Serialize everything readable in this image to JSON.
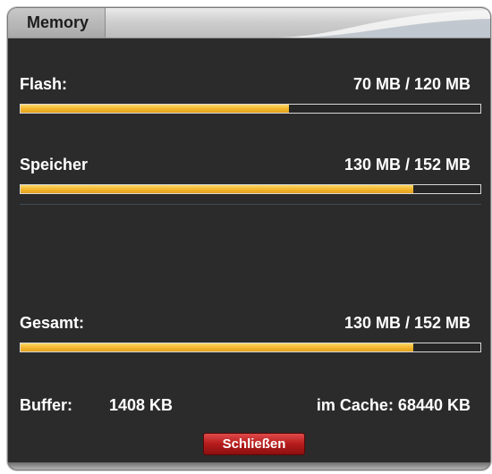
{
  "window": {
    "title": "Memory"
  },
  "flash": {
    "label": "Flash:",
    "value": "70 MB / 120 MB",
    "fill_fraction": 0.583
  },
  "speicher": {
    "label": "Speicher",
    "value": "130 MB / 152 MB",
    "fill_fraction": 0.855
  },
  "gesamt": {
    "label": "Gesamt:",
    "value": "130 MB / 152 MB",
    "fill_fraction": 0.855
  },
  "buffer": {
    "label": "Buffer:",
    "value": "1408 KB"
  },
  "cache": {
    "text": "im Cache: 68440 KB"
  },
  "buttons": {
    "close_label": "Schließen"
  },
  "colors": {
    "bar_fill": "#f4b72e",
    "background": "#2b2b2b",
    "button": "#b51c1c"
  }
}
